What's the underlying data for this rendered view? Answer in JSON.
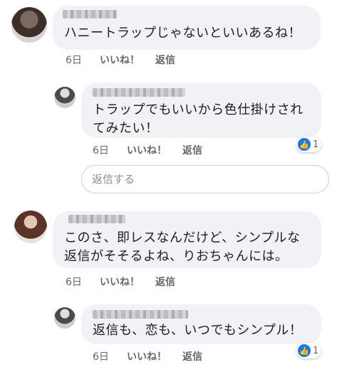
{
  "comments": [
    {
      "text": "ハニートラップじゃないといいあるね！",
      "time": "6日",
      "like_label": "いいね！",
      "reply_label": "返信"
    },
    {
      "text": "トラップでもいいから色仕掛けされてみたい！",
      "time": "6日",
      "like_label": "いいね！",
      "reply_label": "返信",
      "reaction_count": "1"
    },
    {
      "text": "このさ、即レスなんだけど、シンプルな返信がそそるよね、りおちゃんには。",
      "time": "6日",
      "like_label": "いいね！",
      "reply_label": "返信"
    },
    {
      "text": "返信も、恋も、いつでもシンプル！",
      "time": "6日",
      "like_label": "いいね！",
      "reply_label": "返信",
      "reaction_count": "1"
    }
  ],
  "reply_box": {
    "placeholder": "返信する"
  },
  "icons": {
    "reaction": "thumbs-up-icon"
  },
  "colors": {
    "like_blue": "#1877f2",
    "bubble_bg": "#f0f2f5",
    "meta_gray": "#65676b"
  }
}
